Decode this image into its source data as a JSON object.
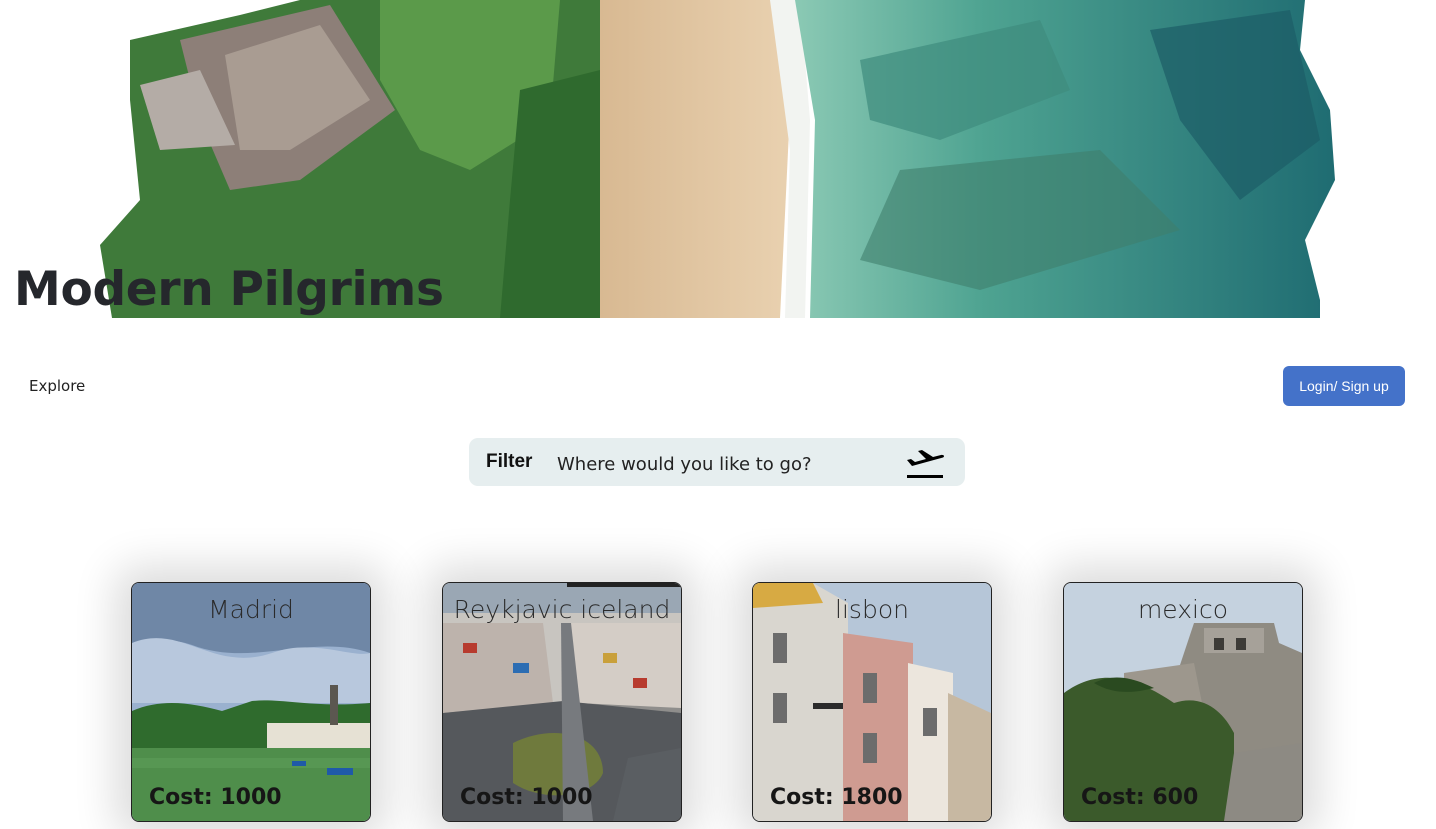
{
  "site": {
    "title": "Modern Pilgrims"
  },
  "nav": {
    "explore_label": "Explore",
    "login_label": "Login/ Sign up"
  },
  "filter": {
    "label": "Filter",
    "placeholder": "Where would you like to go?"
  },
  "destinations": [
    {
      "name": "Madrid",
      "cost": "Cost: 1000"
    },
    {
      "name": "Reykjavic iceland",
      "cost": "Cost: 1000"
    },
    {
      "name": "lisbon",
      "cost": "Cost: 1800"
    },
    {
      "name": "mexico",
      "cost": "Cost: 600"
    }
  ],
  "icons": {
    "filter_submit": "plane-takeoff-icon"
  },
  "colors": {
    "primary_button": "#4472c9",
    "filter_background": "#e6eeef"
  }
}
